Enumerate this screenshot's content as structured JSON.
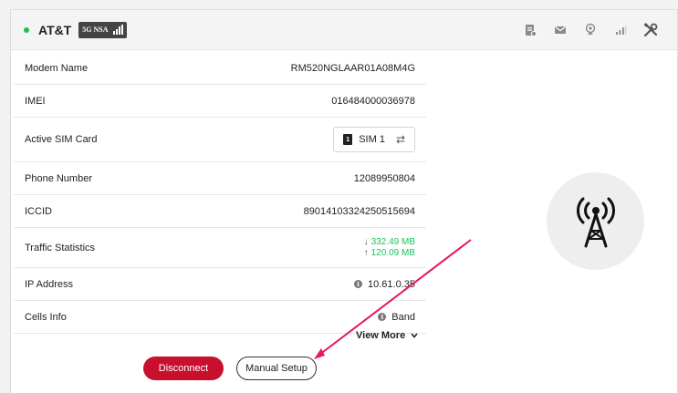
{
  "header": {
    "carrier": "AT&T",
    "network_badge": "5G NSA",
    "status_color": "#1ec04c",
    "icons": [
      "sim-settings-icon",
      "message-icon",
      "location-pin-icon",
      "signal-icon",
      "tools-icon"
    ]
  },
  "info": {
    "modem_name": {
      "label": "Modem Name",
      "value": "RM520NGLAAR01A08M4G"
    },
    "imei": {
      "label": "IMEI",
      "value": "016484000036978"
    },
    "active_sim": {
      "label": "Active SIM Card",
      "value": "SIM 1",
      "sim_number": "1"
    },
    "phone": {
      "label": "Phone Number",
      "value": "12089950804"
    },
    "iccid": {
      "label": "ICCID",
      "value": "89014103324250515694"
    },
    "traffic": {
      "label": "Traffic Statistics",
      "down": "332.49 MB",
      "up": "120.09 MB"
    },
    "ip": {
      "label": "IP Address",
      "value": "10.61.0.35"
    },
    "cells": {
      "label": "Cells Info",
      "value": "Band"
    }
  },
  "view_more": "View More",
  "buttons": {
    "disconnect": "Disconnect",
    "manual_setup": "Manual Setup"
  },
  "colors": {
    "accent_red": "#c8102e",
    "traffic_green": "#19c35a"
  }
}
